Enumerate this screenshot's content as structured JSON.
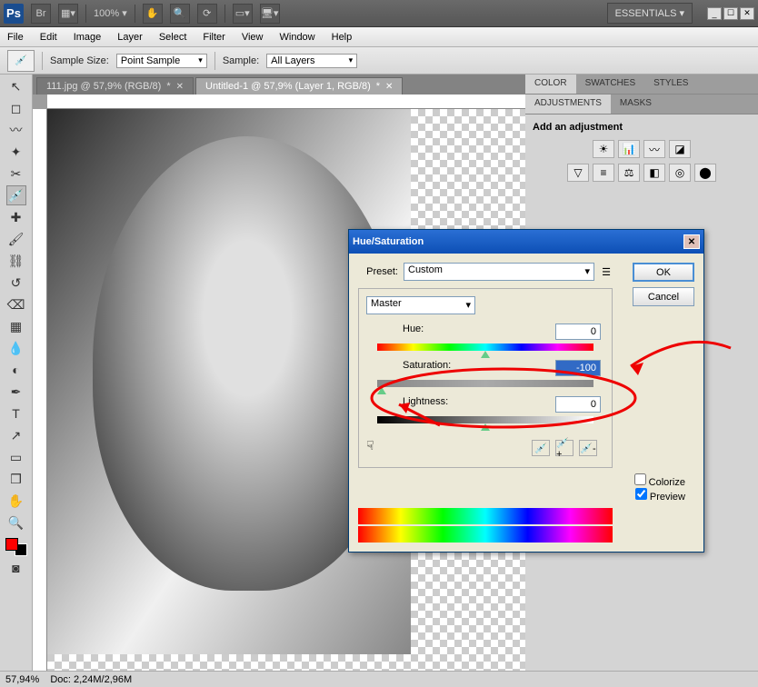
{
  "topbar": {
    "app": "Ps",
    "zoom": "100% ▾",
    "essentials": "ESSENTIALS ▾"
  },
  "menu": [
    "File",
    "Edit",
    "Image",
    "Layer",
    "Select",
    "Filter",
    "View",
    "Window",
    "Help"
  ],
  "options": {
    "sample_size_label": "Sample Size:",
    "sample_size_value": "Point Sample",
    "sample_label": "Sample:",
    "sample_value": "All Layers"
  },
  "tabs": [
    {
      "label": "111.jpg @ 57,9% (RGB/8)",
      "active": false,
      "mod": "*"
    },
    {
      "label": "Untitled-1 @ 57,9% (Layer 1, RGB/8)",
      "active": true,
      "mod": "*"
    }
  ],
  "panels": {
    "color": "COLOR",
    "swatches": "SWATCHES",
    "styles": "STYLES",
    "adjustments": "ADJUSTMENTS",
    "masks": "MASKS",
    "add_adjustment": "Add an adjustment"
  },
  "dialog": {
    "title": "Hue/Saturation",
    "preset_label": "Preset:",
    "preset_value": "Custom",
    "ok": "OK",
    "cancel": "Cancel",
    "channel": "Master",
    "hue_label": "Hue:",
    "hue_value": "0",
    "sat_label": "Saturation:",
    "sat_value": "-100",
    "light_label": "Lightness:",
    "light_value": "0",
    "colorize": "Colorize",
    "preview": "Preview"
  },
  "status": {
    "zoom": "57,94%",
    "doc": "Doc: 2,24M/2,96M"
  }
}
